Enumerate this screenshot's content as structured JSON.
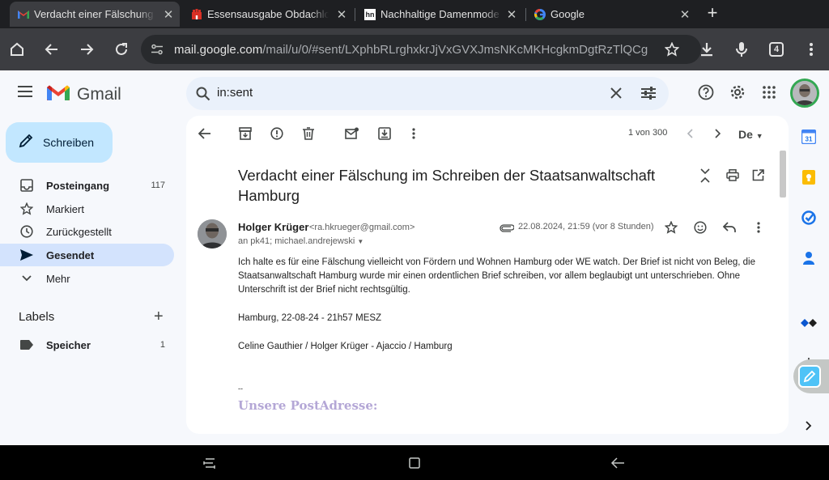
{
  "browser": {
    "tabs": [
      {
        "title": "Verdacht einer Fälschung im Schreiben",
        "active": true,
        "favicon": "gmail-icon"
      },
      {
        "title": "Essensausgabe Obdachlose Hamburg",
        "active": false,
        "favicon": "hamburg-icon"
      },
      {
        "title": "Nachhaltige Damenmode - Nachhaltig",
        "active": false,
        "favicon": "hn-icon"
      },
      {
        "title": "Google",
        "active": false,
        "favicon": "google-icon"
      }
    ],
    "url_host": "mail.google.com",
    "url_path": "/mail/u/0/#sent/LXphbRLrghxkrJjVxGVXJmsNKcMKHcgkmDgtRzTlQCg",
    "tab_count": "4"
  },
  "gmail": {
    "app_name": "Gmail",
    "search_value": "in:sent",
    "compose_label": "Schreiben",
    "nav": [
      {
        "label": "Posteingang",
        "count": "117",
        "bold": true
      },
      {
        "label": "Markiert",
        "count": "",
        "bold": false
      },
      {
        "label": "Zurückgestellt",
        "count": "",
        "bold": false
      },
      {
        "label": "Gesendet",
        "count": "",
        "bold": true
      },
      {
        "label": "Mehr",
        "count": "",
        "bold": false
      }
    ],
    "labels_heading": "Labels",
    "labels": [
      {
        "label": "Speicher",
        "count": "1"
      }
    ]
  },
  "message": {
    "pager": "1 von 300",
    "lang": "De",
    "subject": "Verdacht einer Fälschung im Schreiben der Staatsanwaltschaft Hamburg",
    "sender_name": "Holger Krüger",
    "sender_email": "<ra.hkrueger@gmail.com>",
    "to_line": "an pk41; michael.andrejewski",
    "date": "22.08.2024, 21:59 (vor 8 Stunden)",
    "body_paragraph": "Ich halte es für eine Fälschung vielleicht von Fördern und Wohnen Hamburg oder WE watch. Der Brief ist nicht von Beleg, die Staatsanwaltschaft Hamburg wurde mir einen ordentlichen Brief schreiben, vor allem beglaubigt unt unterschrieben. Ohne Unterschrift ist der Brief nicht rechtsgültig.",
    "body_place_date": "Hamburg, 22-08-24 - 21h57 MESZ",
    "body_names": "Celine Gauthier / Holger Krüger - Ajaccio / Hamburg",
    "signature_sep": "--",
    "signature_heading": "Unsere PostAdresse:"
  },
  "colors": {
    "accent": "#0b57d0",
    "compose_bg": "#c2e7ff",
    "active_nav_bg": "#d3e3fd",
    "signature": "#b4a7d6"
  }
}
